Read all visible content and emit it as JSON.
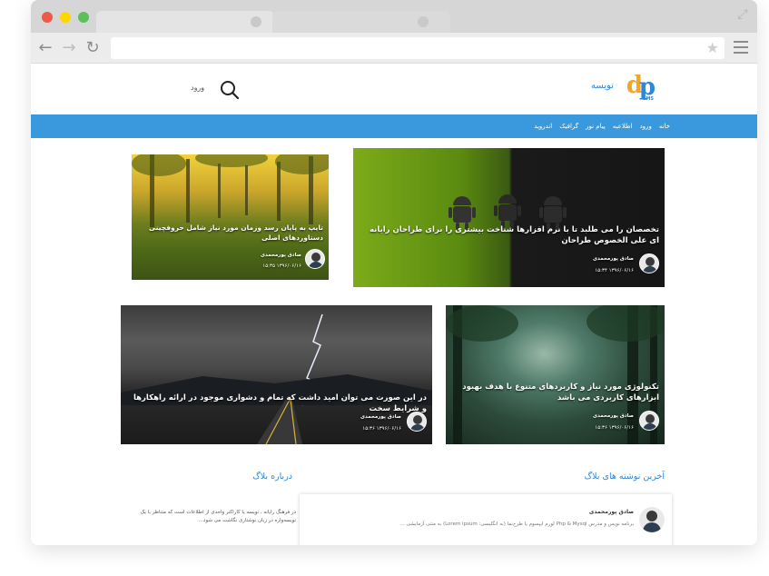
{
  "browser": {
    "window_buttons": [
      "close",
      "minimize",
      "maximize"
    ],
    "url": ""
  },
  "site": {
    "brand_name": "نویسه",
    "logo_sub": "LMS",
    "login_label": "ورود",
    "nav": [
      "خانه",
      "ورود",
      "اطلاعیه",
      "پیام نور",
      "گرافیک",
      "اندروید"
    ]
  },
  "cards": [
    {
      "title": "تخصصان را می طلبد تا با نرم افزارها شناخت بیشتری را برای طراحان رایانه ای علی الخصوص طراحان",
      "author": "صادق پورمحمدی",
      "date": "۱۵:۳۴ ۱۳۹۶/۰۶/۱۶"
    },
    {
      "title": "تایپ به پایان رسد وزمان مورد نیاز شامل حروفچینی دستاوردهای اصلی",
      "author": "صادق پورمحمدی",
      "date": "۱۵:۳۵ ۱۳۹۶/۰۶/۱۶"
    },
    {
      "title": "تکنولوژی مورد نیاز و کاربردهای متنوع با هدف بهبود ابزارهای کاربردی می باشد",
      "author": "صادق پورمحمدی",
      "date": "۱۵:۳۶ ۱۳۹۶/۰۶/۱۶"
    },
    {
      "title": "در این صورت می توان امید داشت که تمام و دشواری موجود در ارائه راهکارها و شرایط سخت",
      "author": "صادق پورمحمدی",
      "date": "۱۵:۳۶ ۱۳۹۶/۰۶/۱۶"
    }
  ],
  "latest": {
    "heading": "آخرین نوشته های بلاگ",
    "author": "صادق پورمحمدی",
    "excerpt": "برنامه نویس و مدرس Php & Mysql لورم ایپسوم یا طرح‌نما (به انگلیسی: Lorem ipsum) به متنی آزمایشی ..."
  },
  "about": {
    "heading": "درباره بلاگ",
    "text": "در فرهنگ رایانه ، نویسه یا کاراکتر واحدی از اطلاعات است که متناظر با یک نویسه‌واره در زبان نوشتاری نگاشت می شود..."
  }
}
